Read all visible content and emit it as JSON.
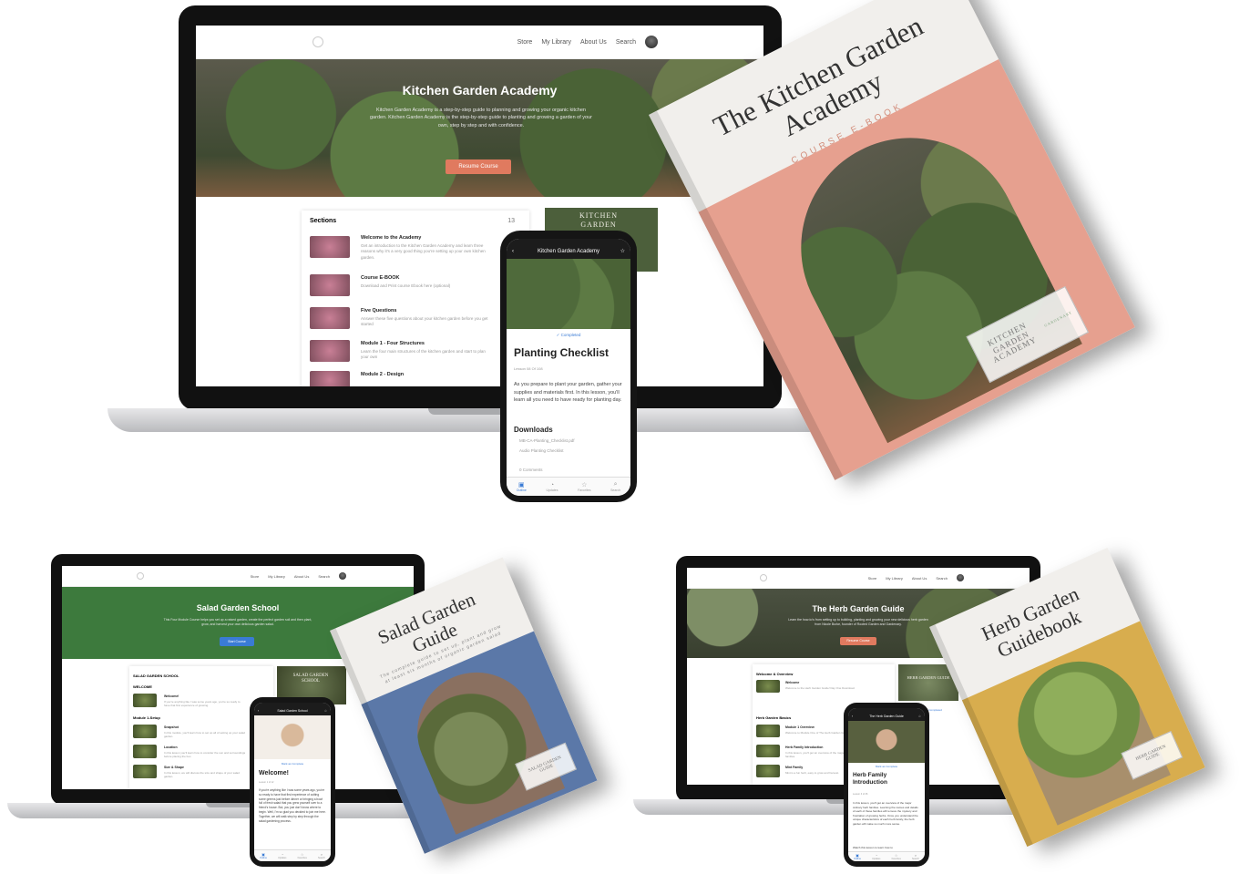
{
  "nav": {
    "store": "Store",
    "library": "My Library",
    "about": "About Us",
    "search": "Search"
  },
  "kitchen": {
    "hero_title": "Kitchen Garden Academy",
    "hero_text": "Kitchen Garden Academy is a step-by-step guide to planning and growing your organic kitchen garden. Kitchen Garden Academy is the step-by-step guide to planting and growing a garden of your own, step by step and with confidence.",
    "cta": "Resume Course",
    "sections_label": "Sections",
    "sections_count": "13",
    "sections": [
      {
        "title": "Welcome to the Academy",
        "desc": "Get an introduction to the Kitchen Garden Academy and learn three reasons why it's a very good thing you're setting up your own kitchen garden."
      },
      {
        "title": "Course E-BOOK",
        "desc": "Download and Print course Ebook here (optional)"
      },
      {
        "title": "Five Questions",
        "desc": "Answer these five questions about your kitchen garden before you get started"
      },
      {
        "title": "Module 1 - Four Structures",
        "desc": "Learn the four main structures of the kitchen garden and start to plan your own"
      },
      {
        "title": "Module 2 - Design",
        "desc": ""
      }
    ],
    "side_card": "KITCHEN GARDEN",
    "phone": {
      "bar": "Kitchen Garden Academy",
      "completed": "✓ Completed",
      "title": "Planting Checklist",
      "meta": "Lesson 08 Of 108",
      "body": "As you prepare to plant your garden, gather your supplies and materials first. In this lesson, you'll learn all you need to have ready for planting day.",
      "downloads": "Downloads",
      "files": [
        "MB-CA-Planting_Checklist.pdf",
        "Audio Planting Checklist"
      ],
      "comments": "0 Comments",
      "tabs": [
        "Outline",
        "Updates",
        "Favorites",
        "Search"
      ]
    },
    "book": {
      "title": "The Kitchen Garden Academy",
      "subtitle": "COURSE E-BOOK",
      "seal": "KITCHEN GARDEN ACADEMY",
      "badge": "GARDENARY"
    }
  },
  "salad": {
    "hero_title": "Salad Garden School",
    "hero_text": "This Four Module Course helps you set up a raised garden, create the perfect garden soil and then plant, grow, and harvest your own delicious garden salad.",
    "cta": "Start Course",
    "school_label": "SALAD GARDEN SCHOOL",
    "welcome_label": "WELCOME",
    "module_label": "Module 1-Setup",
    "items": [
      {
        "title": "Welcome!",
        "desc": "If you're anything like I was some years ago, you're so ready to have that first experience of growing."
      },
      {
        "title": "Snapshot",
        "desc": "In this module, you'll learn how to set up all of setting up your salad garden."
      },
      {
        "title": "Location",
        "desc": "In this lesson you'll learn how to consider the sun and surroundings before placing the box."
      },
      {
        "title": "Size & Shape",
        "desc": "In this lesson, we will discuss the size and shape of your salad garden."
      }
    ],
    "side_card": "SALAD GARDEN SCHOOL",
    "phone": {
      "bar": "Salad Garden School",
      "completed": "Mark as Complete",
      "title": "Welcome!",
      "meta": "Lesson 1 of 12",
      "body": "If you're anything like I was some years ago, you're so ready to have that first experience of cutting some greens just before dinner or bringing a bowl full of fresh salad that you grew yourself over to a friend's house. But, you just don't know where to begin. Well, I'm so glad you decided to join me here. Together, we will walk step by step through the salad gardening process.",
      "tabs": [
        "Outline",
        "Updates",
        "Favorites",
        "Search"
      ]
    },
    "book": {
      "title": "Salad Garden Guide",
      "subtitle": "The complete guide to set up, plant and grow at least six months of organic garden salad",
      "seal": "SALAD GARDEN GUIDE"
    }
  },
  "herb": {
    "hero_title": "The Herb Garden Guide",
    "hero_text": "Learn the how-to's from setting up to building, planting and growing your new delicious herb garden from Nicole Burke, founder of Rooted Garden and Gardenary.",
    "cta": "Resume Course",
    "sections": [
      {
        "header": "Welcome & Overview",
        "title": "Welcome",
        "desc": "Welcome to the Herb Garden Guide! Day One Download."
      },
      {
        "header": "Herb Garden Basics",
        "title": "Module 1 Overview",
        "desc": "Welcome to Module One of The Herb Garden Guide."
      },
      {
        "title": "Herb Family Introduction",
        "desc": "In this lesson, you'll get an overview of the major culinary herb families."
      },
      {
        "title": "Mint Family",
        "desc": "Mint is a fun herb, easy to grow and harvest."
      }
    ],
    "side_card": "HERB GARDEN GUIDE",
    "side_completed": "✓ Completed",
    "side_basics": "Herb Garden Basics",
    "phone": {
      "bar": "The Herb Garden Guide",
      "completed": "Mark as Complete",
      "title": "Herb Family Introduction",
      "meta": "Lesson 3 of 36",
      "body": "In this lesson, you'll get an overview of the major culinary herb families. Learning the names and details of each of these families will remove the mystery and frustration of growing herbs. Once you understand the unique characteristics of each herb family, the herb garden will make so much more sense.",
      "watch": "Watch this lesson to learn how to",
      "tabs": [
        "Outline",
        "Updates",
        "Favorites",
        "Search"
      ]
    },
    "book": {
      "title": "Herb Garden Guidebook",
      "seal": "HERB GARDEN GUIDE"
    }
  },
  "colors": {
    "salmon": "#e6a08f",
    "salad_green": "#3d7a3d",
    "herb_gold": "#d8ad4e",
    "salad_blue": "#5b78a8",
    "blue": "#3a7bd5"
  }
}
